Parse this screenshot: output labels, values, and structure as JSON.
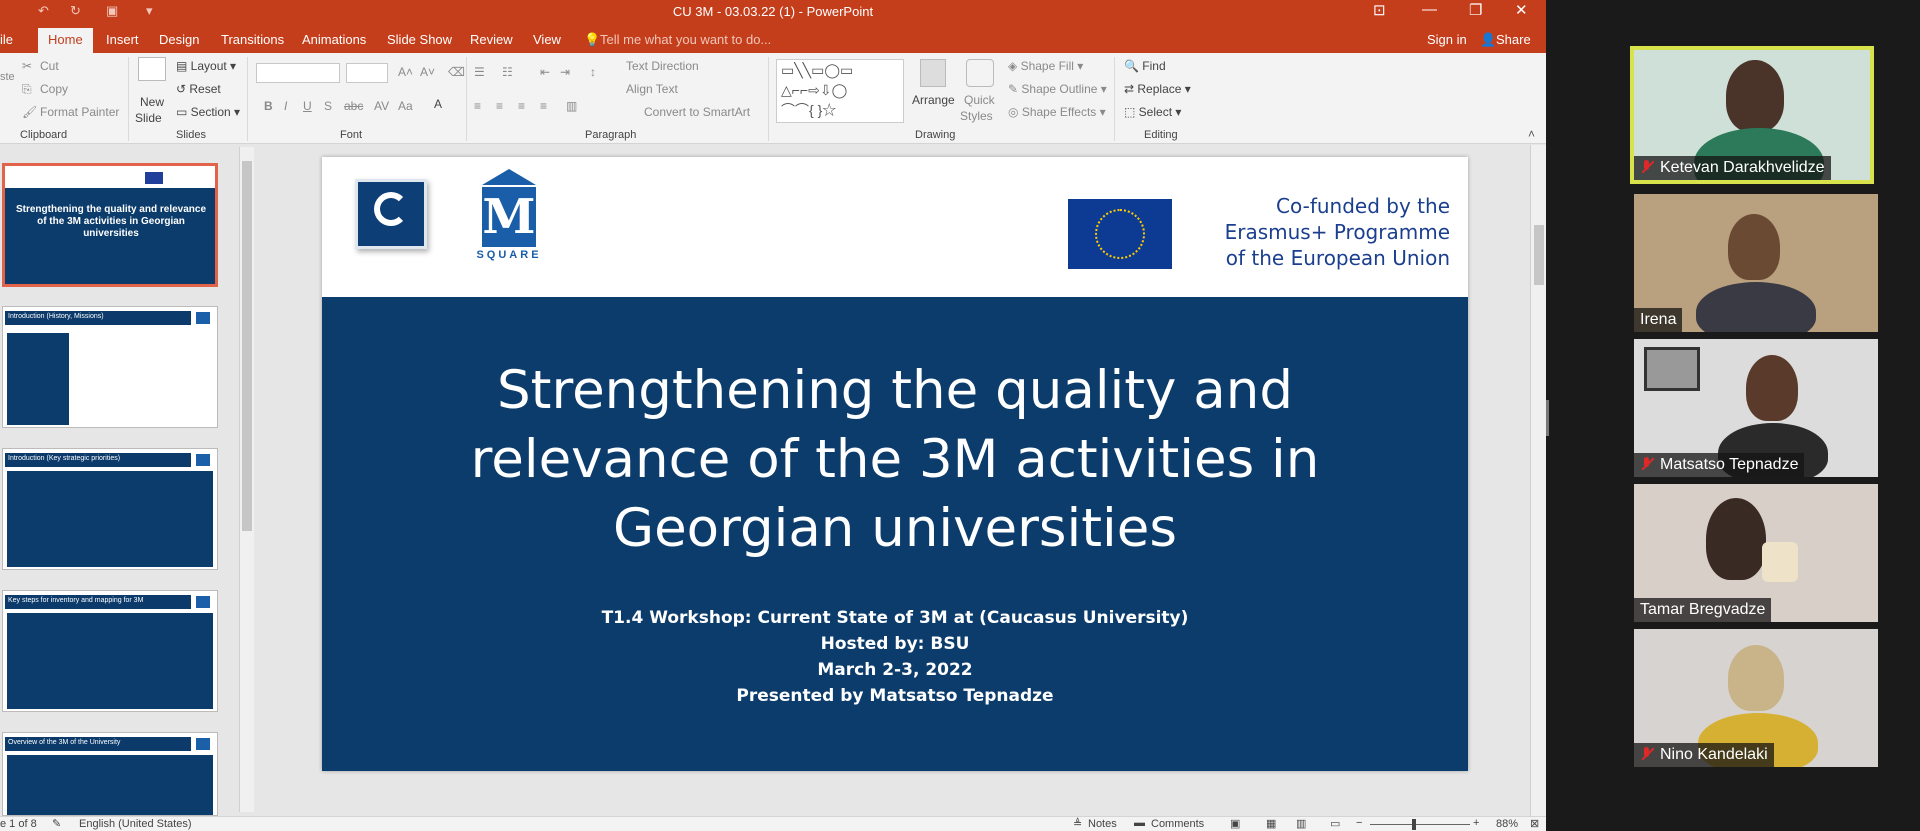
{
  "window": {
    "title": "CU 3M - 03.03.22 (1) - PowerPoint"
  },
  "tabs": [
    "ile",
    "Home",
    "Insert",
    "Design",
    "Transitions",
    "Animations",
    "Slide Show",
    "Review",
    "View"
  ],
  "tell_me": "Tell me what you want to do...",
  "account": {
    "sign_in": "Sign in",
    "share": "Share"
  },
  "ribbon": {
    "clipboard": {
      "cut": "Cut",
      "copy": "Copy",
      "format_painter": "Format Painter",
      "paste": "ste",
      "label": "Clipboard"
    },
    "slides": {
      "new_slide": "New",
      "new_slide2": "Slide",
      "layout": "Layout",
      "reset": "Reset",
      "section": "Section",
      "label": "Slides"
    },
    "font": {
      "label": "Font"
    },
    "paragraph": {
      "text_direction": "Text Direction",
      "align_text": "Align Text",
      "smartart": "Convert to SmartArt",
      "label": "Paragraph"
    },
    "drawing": {
      "arrange": "Arrange",
      "quick_styles": "Quick",
      "quick_styles2": "Styles",
      "shape_fill": "Shape Fill",
      "shape_outline": "Shape Outline",
      "shape_effects": "Shape Effects",
      "label": "Drawing"
    },
    "editing": {
      "find": "Find",
      "replace": "Replace",
      "select": "Select",
      "label": "Editing"
    }
  },
  "thumbnails": [
    {
      "header": "Strengthening the quality and relevance of the 3M activities in Georgian universities"
    },
    {
      "header": "Introduction (History, Missions)"
    },
    {
      "header": "Introduction (Key strategic priorities)"
    },
    {
      "header": "Key steps for inventory and mapping for 3M"
    },
    {
      "header": "Overview of the 3M of the University"
    }
  ],
  "slide": {
    "cofunded_1": "Co-funded by the",
    "cofunded_2": "Erasmus+ Programme",
    "cofunded_3": "of the European Union",
    "logo_text": "SQUARE",
    "title_1": "Strengthening the quality and",
    "title_2": "relevance of the 3M activities in",
    "title_3": "Georgian universities",
    "sub_1": "T1.4 Workshop: Current State of 3M at (Caucasus University)",
    "sub_2": "Hosted by: BSU",
    "sub_3": "March 2-3, 2022",
    "sub_4": "Presented by Matsatso Tepnadze"
  },
  "status": {
    "slide_of": "e 1 of 8",
    "language": "English (United States)",
    "notes": "Notes",
    "comments": "Comments",
    "zoom": "88%"
  },
  "participants": [
    {
      "name": "Ketevan Darakhvelidze",
      "muted": true,
      "active": true
    },
    {
      "name": "Irena",
      "muted": false,
      "active": false
    },
    {
      "name": "Matsatso Tepnadze",
      "muted": true,
      "active": false
    },
    {
      "name": "Tamar Bregvadze",
      "muted": false,
      "active": false
    },
    {
      "name": "Nino Kandelaki",
      "muted": true,
      "active": false
    }
  ],
  "colors": {
    "powerpoint_accent": "#c43e1c",
    "slide_band": "#0c3c6b",
    "active_speaker_border": "#d8e24a"
  }
}
